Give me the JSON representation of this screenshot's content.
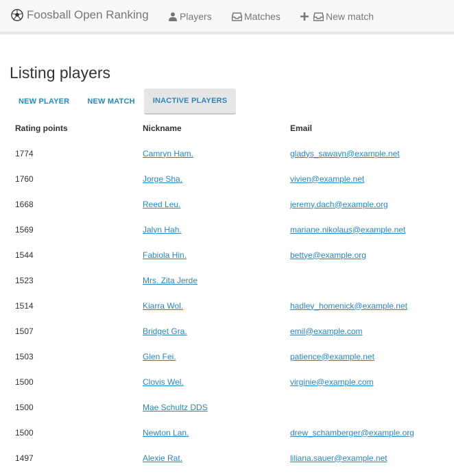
{
  "navbar": {
    "brand": "Foosball Open Ranking",
    "links": [
      {
        "label": "Players",
        "icon": "user-icon"
      },
      {
        "label": "Matches",
        "icon": "inbox-icon"
      },
      {
        "label": "New match",
        "icon": "plus-inbox-icon"
      }
    ]
  },
  "page": {
    "title": "Listing players",
    "buttons": [
      "New player",
      "New match",
      "Inactive players"
    ]
  },
  "table": {
    "headers": [
      "Rating points",
      "Nickname",
      "Email"
    ],
    "rows": [
      {
        "rating": "1774",
        "nickname": "Camryn Ham.",
        "email": "gladys_sawayn@example.net"
      },
      {
        "rating": "1760",
        "nickname": "Jorge Sha.",
        "email": "vivien@example.net"
      },
      {
        "rating": "1668",
        "nickname": "Reed Leu.",
        "email": "jeremy.dach@example.org"
      },
      {
        "rating": "1569",
        "nickname": "Jalyn Hah.",
        "email": "mariane.nikolaus@example.net"
      },
      {
        "rating": "1544",
        "nickname": "Fabiola Hin.",
        "email": "bettye@example.org"
      },
      {
        "rating": "1523",
        "nickname": "Mrs. Zita Jerde",
        "email": ""
      },
      {
        "rating": "1514",
        "nickname": "Kiarra Wol.",
        "email": "hadley_homenick@example.net"
      },
      {
        "rating": "1507",
        "nickname": "Bridget Gra.",
        "email": "emil@example.com"
      },
      {
        "rating": "1503",
        "nickname": "Glen Fei.",
        "email": "patience@example.net"
      },
      {
        "rating": "1500",
        "nickname": "Clovis Wel.",
        "email": "virginie@example.com"
      },
      {
        "rating": "1500",
        "nickname": "Mae Schultz DDS",
        "email": ""
      },
      {
        "rating": "1500",
        "nickname": "Newton Lan.",
        "email": "drew_schamberger@example.org"
      },
      {
        "rating": "1497",
        "nickname": "Alexie Rat.",
        "email": "liliana.sauer@example.net"
      }
    ]
  }
}
